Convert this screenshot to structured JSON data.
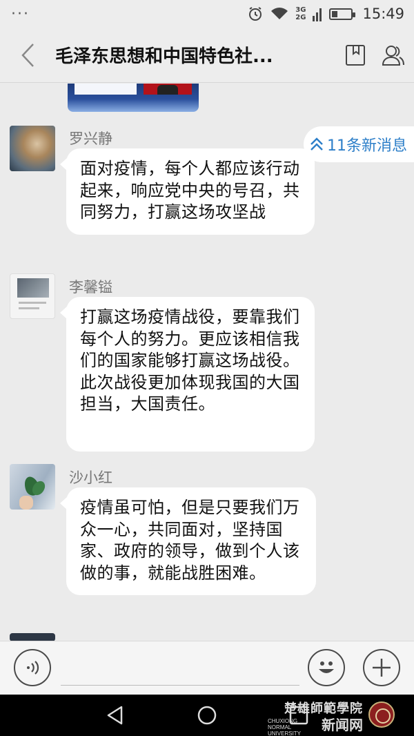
{
  "status_bar": {
    "left_indicator": "···",
    "network_top": "3G",
    "network_bottom": "2G",
    "battery_level_percent": 30,
    "time": "15:49",
    "icons": [
      "alarm-icon",
      "wifi-icon",
      "signal-icon",
      "battery-icon"
    ]
  },
  "header": {
    "back_icon": "chevron-left-icon",
    "title": "毛泽东思想和中国特色社...",
    "icons": [
      "bookmark-icon",
      "group-members-icon"
    ]
  },
  "new_messages_badge": {
    "icon": "double-chevron-up-icon",
    "label": "11条新消息",
    "color": "#2d7fc9"
  },
  "messages": [
    {
      "sender": "罗兴静",
      "text": "面对疫情，每个人都应该行动起来，响应党中央的号召，共同努力，打赢这场攻坚战"
    },
    {
      "sender": "李馨镒",
      "text": "打赢这场疫情战役，要靠我们每个人的努力。更应该相信我们的国家能够打赢这场战役。此次战役更加体现我国的大国担当，大国责任。"
    },
    {
      "sender": "沙小红",
      "text": "疫情虽可怕，但是只要我们万众一心，共同面对，坚持国家、政府的领导，做到个人该做的事，就能战胜困难。"
    }
  ],
  "input_bar": {
    "text_value": "",
    "icons": [
      "voice-icon",
      "emoji-icon",
      "plus-icon"
    ]
  },
  "nav_bar": {
    "icons": [
      "nav-back-icon",
      "nav-home-icon",
      "nav-recent-icon"
    ]
  },
  "watermark": {
    "line1": "楚雄師範學院",
    "line2": "新闻网",
    "english": "CHUXIONG NORMAL UNIVERSITY"
  }
}
